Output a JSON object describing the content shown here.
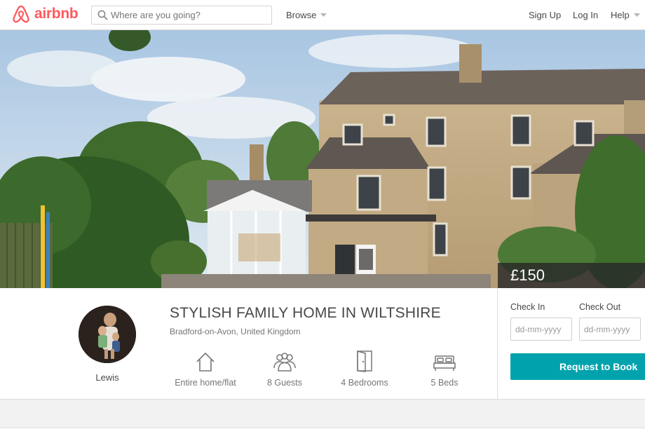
{
  "header": {
    "logo_text": "airbnb",
    "search_placeholder": "Where are you going?",
    "browse_label": "Browse",
    "signup_label": "Sign Up",
    "login_label": "Log In",
    "help_label": "Help"
  },
  "listing": {
    "price": "£150",
    "title": "STYLISH FAMILY HOME IN WILTSHIRE",
    "location": "Bradford-on-Avon, United Kingdom",
    "host_name": "Lewis",
    "amenities": [
      {
        "icon": "home-icon",
        "label": "Entire home/flat"
      },
      {
        "icon": "guests-icon",
        "label": "8 Guests"
      },
      {
        "icon": "door-icon",
        "label": "4 Bedrooms"
      },
      {
        "icon": "bed-icon",
        "label": "5 Beds"
      }
    ]
  },
  "booking": {
    "checkin_label": "Check In",
    "checkout_label": "Check Out",
    "checkin_placeholder": "dd-mm-yyyy",
    "checkout_placeholder": "dd-mm-yyyy",
    "button_label": "Request to Book"
  },
  "colors": {
    "brand": "#ff5a5f",
    "accent": "#00a3ad"
  }
}
